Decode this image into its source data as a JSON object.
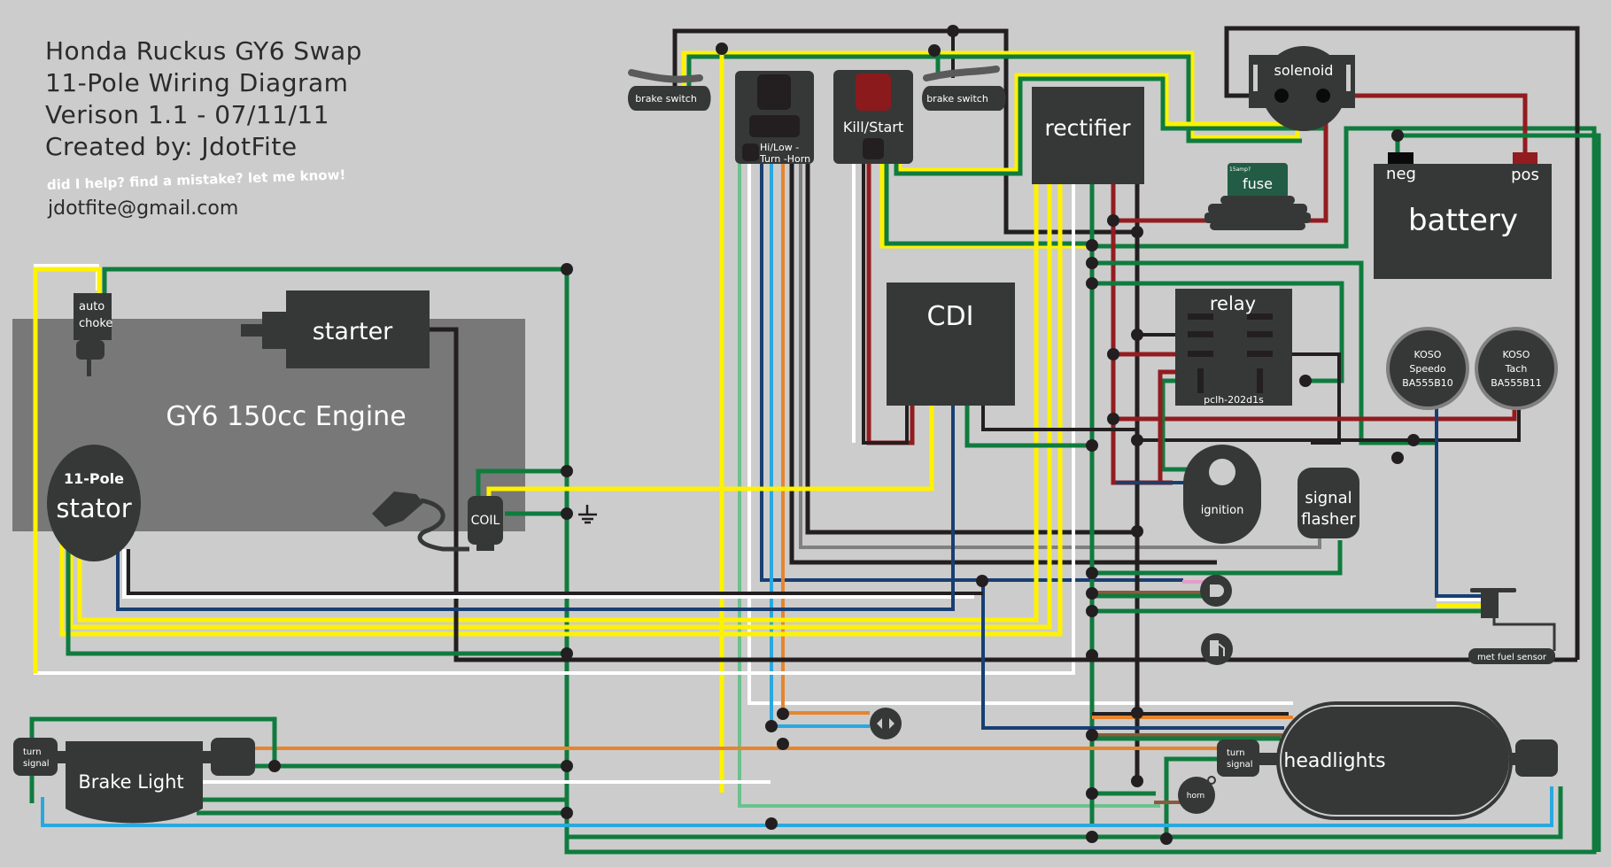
{
  "header": {
    "title_line1": "Honda Ruckus GY6 Swap",
    "title_line2": "11-Pole Wiring Diagram",
    "version_line": "Verison 1.1 - 07/11/11",
    "author_line": "Created by: JdotFite",
    "note": "did I help? find a mistake? let me know!",
    "email": "jdotfite@gmail.com"
  },
  "components": {
    "engine": "GY6 150cc Engine",
    "starter": "starter",
    "auto_choke_1": "auto",
    "auto_choke_2": "choke",
    "stator_1": "11-Pole",
    "stator_2": "stator",
    "coil": "COIL",
    "brake_switch_left": "brake switch",
    "brake_switch_right": "brake switch",
    "hilow_1": "Hi/Low -",
    "hilow_2": "Turn -Horn",
    "kill_start": "Kill/Start",
    "rectifier": "rectifier",
    "solenoid": "solenoid",
    "fuse_rating": "15amp?",
    "fuse": "fuse",
    "battery": "battery",
    "battery_neg": "neg",
    "battery_pos": "pos",
    "cdi": "CDI",
    "relay": "relay",
    "relay_model": "pclh-202d1s",
    "speedo_1": "KOSO",
    "speedo_2": "Speedo",
    "speedo_3": "BA555B10",
    "tach_1": "KOSO",
    "tach_2": "Tach",
    "tach_3": "BA555B11",
    "ignition": "ignition",
    "flasher_1": "signal",
    "flasher_2": "flasher",
    "fuel_sensor": "met fuel sensor",
    "headlights": "headlights",
    "turn_signal_front_1": "turn",
    "turn_signal_front_2": "signal",
    "horn": "horn",
    "brake_light": "Brake Light",
    "turn_signal_rear_1": "turn",
    "turn_signal_rear_2": "signal"
  },
  "colors": {
    "background": "#cccccc",
    "component": "#363838",
    "engine_block": "#787878",
    "wire_black": "#231f20",
    "wire_yellow": "#fff200",
    "wire_green": "#0f7b3e",
    "wire_light_green": "#6cc18e",
    "wire_red": "#921c1f",
    "wire_white": "#ffffff",
    "wire_blue": "#29a8e0",
    "wire_dark_blue": "#183f72",
    "wire_orange": "#e6852d",
    "wire_gray": "#808080",
    "wire_brown": "#8b5a3c",
    "wire_pink": "#e59ccc",
    "fuse_green": "#225c45",
    "kill_button_red": "#8b1a1c"
  }
}
